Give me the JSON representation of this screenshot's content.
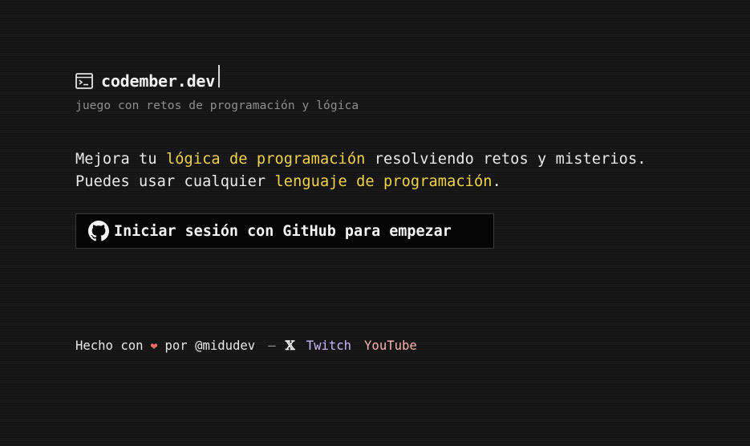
{
  "header": {
    "brand": "codember.dev",
    "tagline": "juego con retos de programación y lógica"
  },
  "intro": {
    "line1_pre": "Mejora tu ",
    "line1_highlight": "lógica de programación",
    "line1_post": " resolviendo retos y misterios.",
    "line2_pre": "Puedes usar cualquier ",
    "line2_highlight": "lenguaje de programación",
    "line2_post": "."
  },
  "login": {
    "label": "Iniciar sesión con GitHub para empezar",
    "icon": "github-icon"
  },
  "footer": {
    "made_with": "Hecho con",
    "by": "por @midudev",
    "separator": "—",
    "x_label": "𝕏",
    "twitch_label": "Twitch",
    "youtube_label": "YouTube"
  },
  "colors": {
    "highlight": "#f1d24b",
    "twitch": "#c9b6ff",
    "youtube": "#ffb2b2",
    "heart": "#f06a6a"
  }
}
